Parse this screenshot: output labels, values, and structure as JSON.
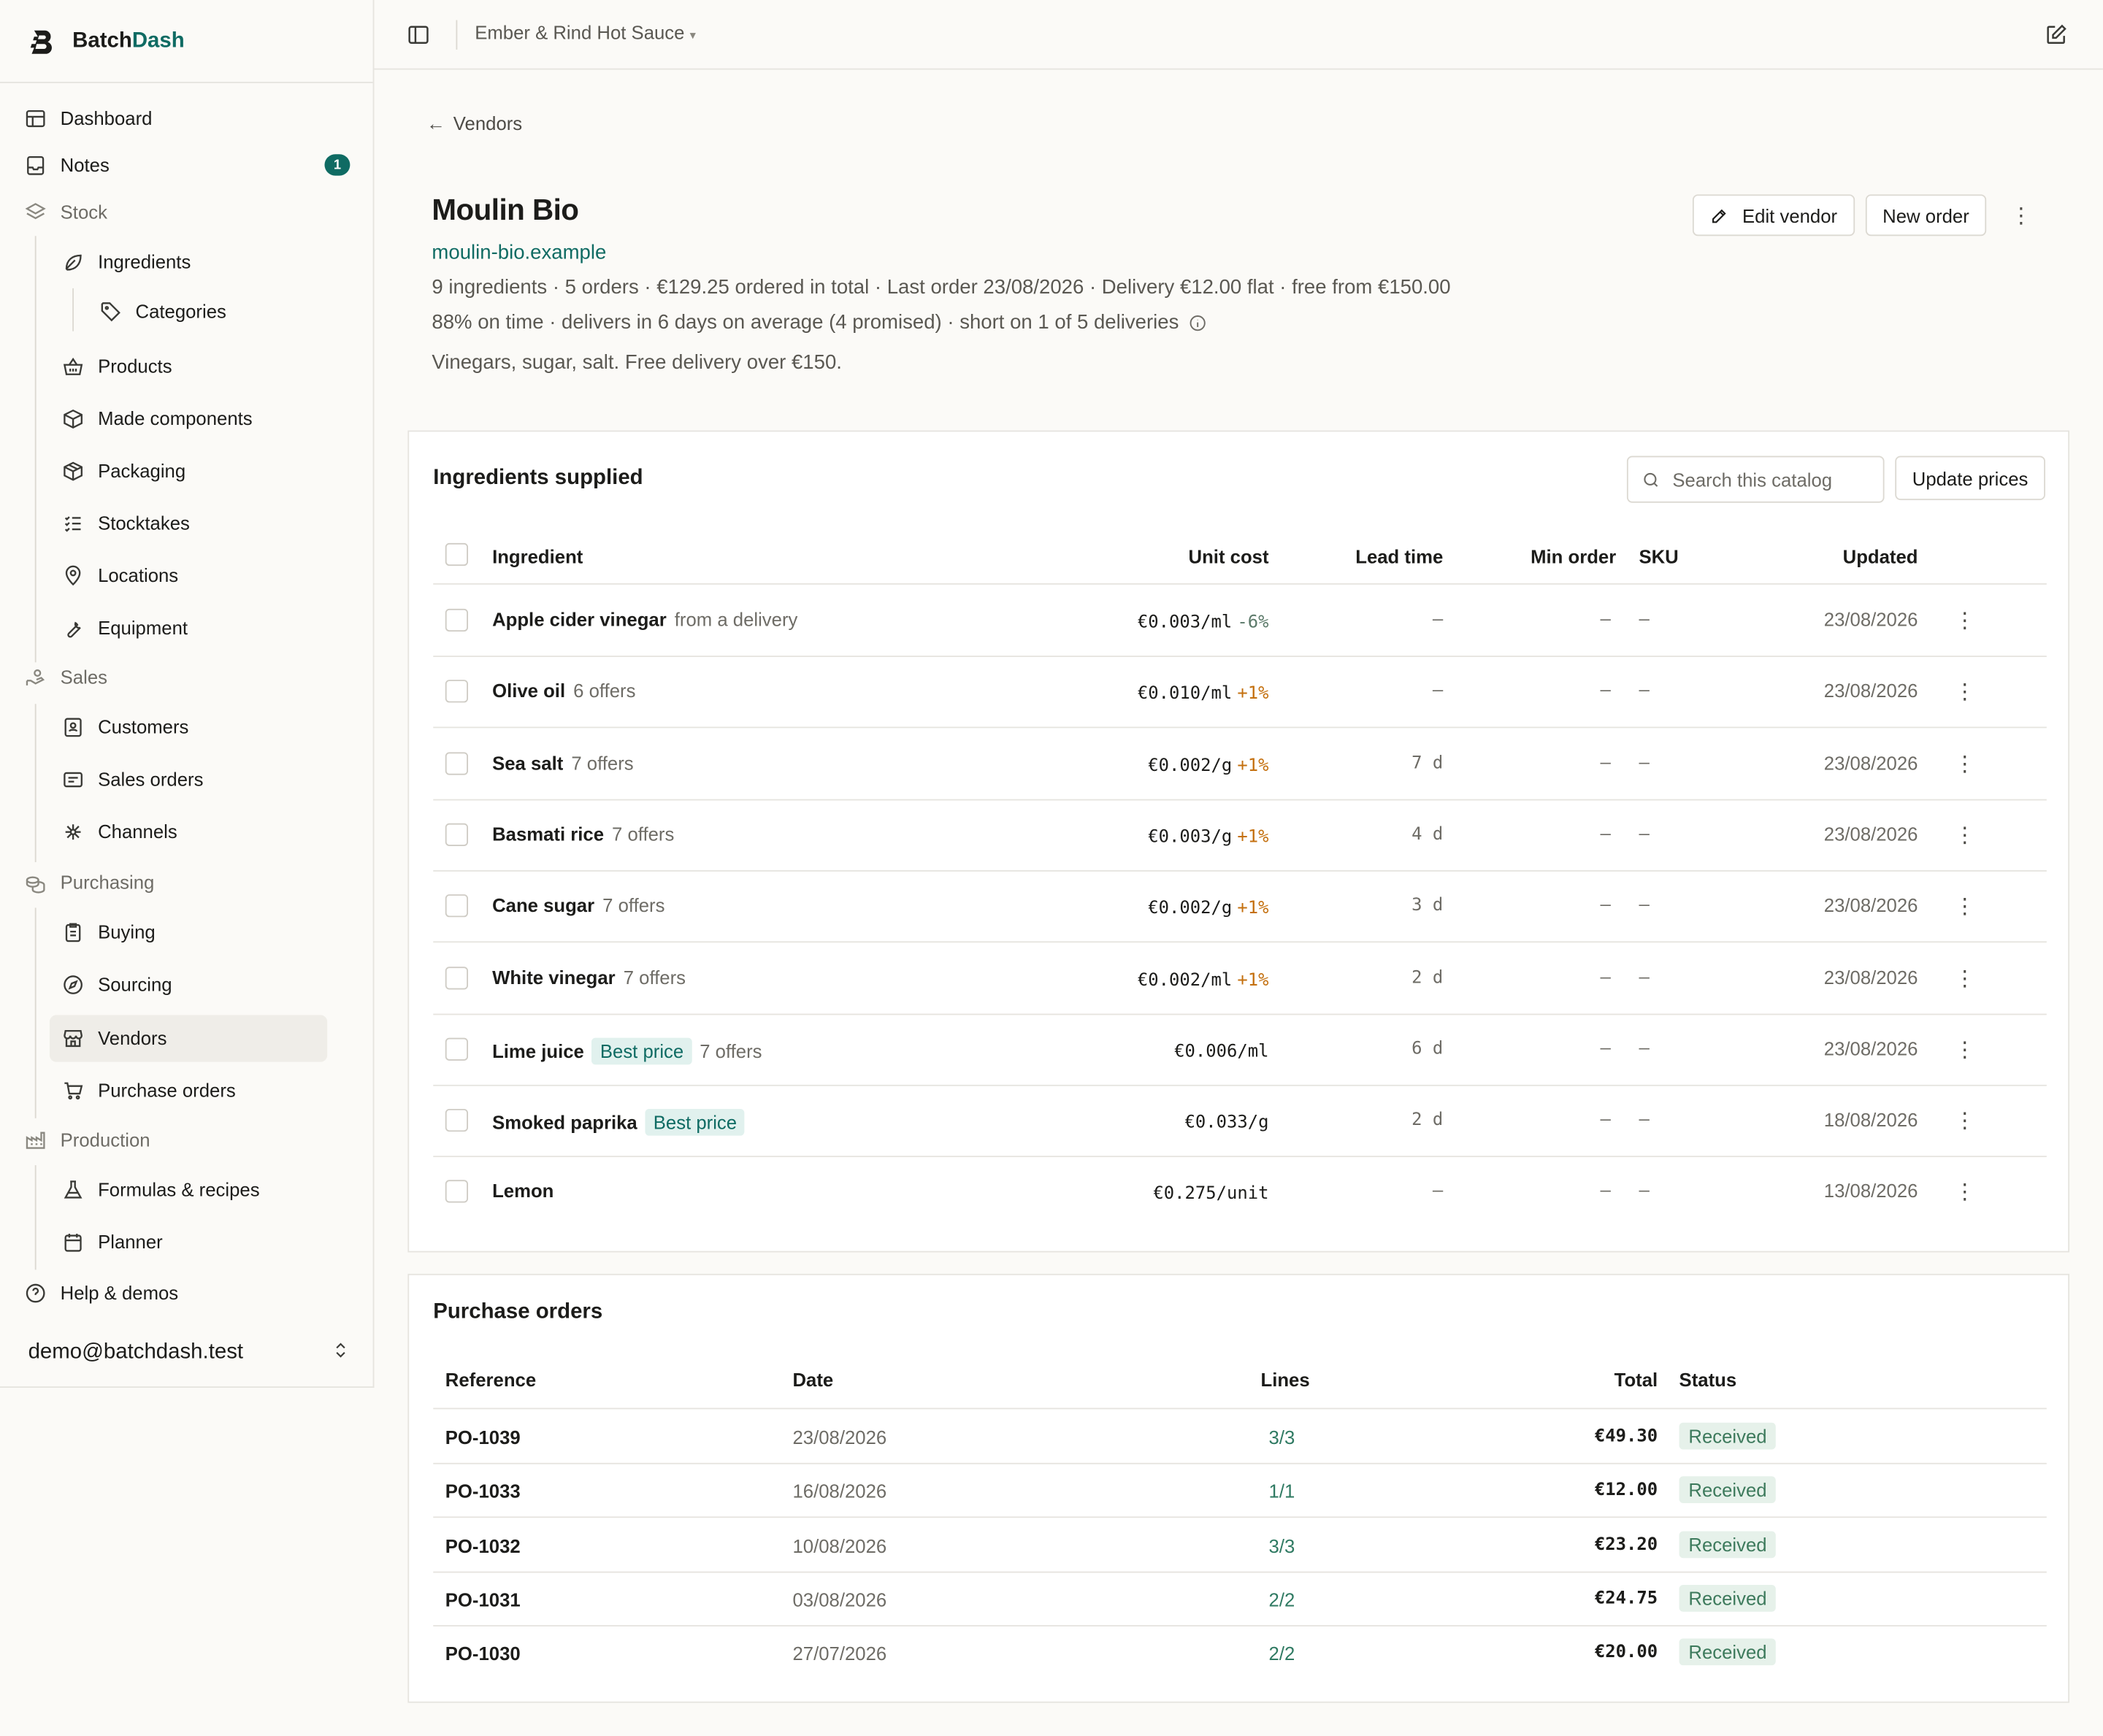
{
  "app": {
    "brand_prefix": "Batch",
    "brand_suffix": "Dash",
    "workspace": "Ember & Rind Hot Sauce",
    "workspace_caret": "▾"
  },
  "sidebar": {
    "items": [
      {
        "label": "Dashboard",
        "icon": "dashboard-icon"
      },
      {
        "label": "Notes",
        "icon": "inbox-icon",
        "badge": "1"
      },
      {
        "label": "Stock",
        "icon": "layers-icon"
      },
      {
        "label": "Ingredients",
        "icon": "leaf-icon"
      },
      {
        "label": "Categories",
        "icon": "tag-icon"
      },
      {
        "label": "Products",
        "icon": "basket-icon"
      },
      {
        "label": "Made components",
        "icon": "box-icon"
      },
      {
        "label": "Packaging",
        "icon": "package-icon"
      },
      {
        "label": "Stocktakes",
        "icon": "checklist-icon"
      },
      {
        "label": "Locations",
        "icon": "map-pin-icon"
      },
      {
        "label": "Equipment",
        "icon": "wrench-icon"
      },
      {
        "label": "Sales",
        "icon": "hand-coins-icon"
      },
      {
        "label": "Customers",
        "icon": "contact-icon"
      },
      {
        "label": "Sales orders",
        "icon": "receipt-icon"
      },
      {
        "label": "Channels",
        "icon": "network-icon"
      },
      {
        "label": "Purchasing",
        "icon": "coins-icon"
      },
      {
        "label": "Buying",
        "icon": "clipboard-icon"
      },
      {
        "label": "Sourcing",
        "icon": "compass-icon"
      },
      {
        "label": "Vendors",
        "icon": "store-icon"
      },
      {
        "label": "Purchase orders",
        "icon": "cart-icon"
      },
      {
        "label": "Production",
        "icon": "factory-icon"
      },
      {
        "label": "Formulas & recipes",
        "icon": "flask-icon"
      },
      {
        "label": "Planner",
        "icon": "calendar-icon"
      },
      {
        "label": "Help & demos",
        "icon": "help-icon"
      }
    ],
    "user": "demo@batchdash.test",
    "user_caret": "⌃⌄"
  },
  "header": {
    "back_label": "Vendors",
    "title": "Moulin Bio",
    "site": "moulin-bio.example",
    "meta1": "9 ingredients · 5 orders · €129.25 ordered in total · Last order 23/08/2026 · Delivery €12.00 flat · free from €150.00",
    "meta2": "88% on time · delivers in 6 days on average (4 promised) · short on 1 of 5 deliveries",
    "notes": "Vinegars, sugar, salt. Free delivery over €150.",
    "edit_label": "Edit vendor",
    "new_order_label": "New order"
  },
  "ingredients": {
    "title": "Ingredients supplied",
    "search_placeholder": "Search this catalog",
    "update_label": "Update prices",
    "columns": [
      "Ingredient",
      "Unit cost",
      "Lead time",
      "Min order",
      "SKU",
      "Updated"
    ],
    "rows": [
      {
        "name": "Apple cider vinegar",
        "sub": "from a delivery",
        "pill": "",
        "cost": "€0.003/ml",
        "delta": "-6%",
        "dir": "down",
        "lead": "–",
        "min": "–",
        "sku": "–",
        "updated": "23/08/2026"
      },
      {
        "name": "Olive oil",
        "sub": "6 offers",
        "pill": "",
        "cost": "€0.010/ml",
        "delta": "+1%",
        "dir": "up",
        "lead": "–",
        "min": "–",
        "sku": "–",
        "updated": "23/08/2026"
      },
      {
        "name": "Sea salt",
        "sub": "7 offers",
        "pill": "",
        "cost": "€0.002/g",
        "delta": "+1%",
        "dir": "up",
        "lead": "7 d",
        "min": "–",
        "sku": "–",
        "updated": "23/08/2026"
      },
      {
        "name": "Basmati rice",
        "sub": "7 offers",
        "pill": "",
        "cost": "€0.003/g",
        "delta": "+1%",
        "dir": "up",
        "lead": "4 d",
        "min": "–",
        "sku": "–",
        "updated": "23/08/2026"
      },
      {
        "name": "Cane sugar",
        "sub": "7 offers",
        "pill": "",
        "cost": "€0.002/g",
        "delta": "+1%",
        "dir": "up",
        "lead": "3 d",
        "min": "–",
        "sku": "–",
        "updated": "23/08/2026"
      },
      {
        "name": "White vinegar",
        "sub": "7 offers",
        "pill": "",
        "cost": "€0.002/ml",
        "delta": "+1%",
        "dir": "up",
        "lead": "2 d",
        "min": "–",
        "sku": "–",
        "updated": "23/08/2026"
      },
      {
        "name": "Lime juice",
        "sub": "7 offers",
        "pill": "Best price",
        "cost": "€0.006/ml",
        "delta": "",
        "dir": "",
        "lead": "6 d",
        "min": "–",
        "sku": "–",
        "updated": "23/08/2026"
      },
      {
        "name": "Smoked paprika",
        "sub": "",
        "pill": "Best price",
        "cost": "€0.033/g",
        "delta": "",
        "dir": "",
        "lead": "2 d",
        "min": "–",
        "sku": "–",
        "updated": "18/08/2026"
      },
      {
        "name": "Lemon",
        "sub": "",
        "pill": "",
        "cost": "€0.275/unit",
        "delta": "",
        "dir": "",
        "lead": "–",
        "min": "–",
        "sku": "–",
        "updated": "13/08/2026"
      }
    ]
  },
  "purchase_orders": {
    "title": "Purchase orders",
    "columns": [
      "Reference",
      "Date",
      "Lines",
      "Total",
      "Status"
    ],
    "rows": [
      {
        "ref": "PO-1039",
        "date": "23/08/2026",
        "lines": "3/3",
        "total": "€49.30",
        "status": "Received"
      },
      {
        "ref": "PO-1033",
        "date": "16/08/2026",
        "lines": "1/1",
        "total": "€12.00",
        "status": "Received"
      },
      {
        "ref": "PO-1032",
        "date": "10/08/2026",
        "lines": "3/3",
        "total": "€23.20",
        "status": "Received"
      },
      {
        "ref": "PO-1031",
        "date": "03/08/2026",
        "lines": "2/2",
        "total": "€24.75",
        "status": "Received"
      },
      {
        "ref": "PO-1030",
        "date": "27/07/2026",
        "lines": "2/2",
        "total": "€20.00",
        "status": "Received"
      }
    ]
  },
  "colors": {
    "accent": "#0f6b63",
    "price_up": "#c4700f",
    "price_down": "#5c7a6a",
    "status_bg": "#e6f1ea"
  }
}
